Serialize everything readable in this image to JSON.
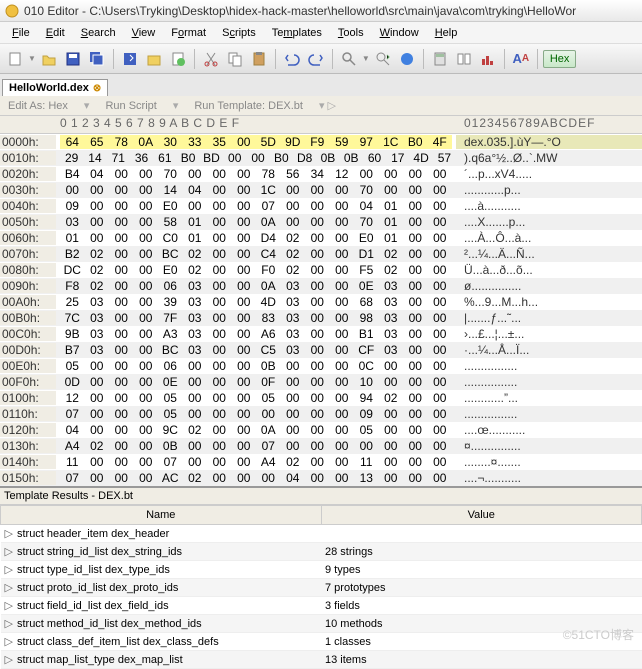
{
  "title": "010 Editor - C:\\Users\\Tryking\\Desktop\\hidex-hack-master\\helloworld\\src\\main\\java\\com\\tryking\\HelloWor",
  "menus": [
    "File",
    "Edit",
    "Search",
    "View",
    "Format",
    "Scripts",
    "Templates",
    "Tools",
    "Window",
    "Help"
  ],
  "tab": "HelloWorld.dex",
  "subbar": {
    "edit_as": "Edit As: Hex",
    "run_script": "Run Script",
    "run_template": "Run Template: DEX.bt"
  },
  "hex_header_bytes": "0  1  2  3  4  5  6  7  8  9  A  B  C  D  E  F",
  "hex_header_ascii": "0123456789ABCDEF",
  "rows": [
    {
      "a": "0000h:",
      "b": [
        "64",
        "65",
        "78",
        "0A",
        "30",
        "33",
        "35",
        "00",
        "5D",
        "9D",
        "F9",
        "59",
        "97",
        "1C",
        "B0",
        "4F"
      ],
      "t": "dex.035.].ùY—.°O",
      "hl": true
    },
    {
      "a": "0010h:",
      "b": [
        "29",
        "14",
        "71",
        "36",
        "61",
        "B0",
        "BD",
        "00",
        "00",
        "B0",
        "D8",
        "0B",
        "0B",
        "60",
        "17",
        "4D",
        "57"
      ],
      "t": ").q6a°½..Ø..`.MW"
    },
    {
      "a": "0020h:",
      "b": [
        "B4",
        "04",
        "00",
        "00",
        "70",
        "00",
        "00",
        "00",
        "78",
        "56",
        "34",
        "12",
        "00",
        "00",
        "00",
        "00"
      ],
      "t": "´...p...xV4....."
    },
    {
      "a": "0030h:",
      "b": [
        "00",
        "00",
        "00",
        "00",
        "14",
        "04",
        "00",
        "00",
        "1C",
        "00",
        "00",
        "00",
        "70",
        "00",
        "00",
        "00"
      ],
      "t": "............p..."
    },
    {
      "a": "0040h:",
      "b": [
        "09",
        "00",
        "00",
        "00",
        "E0",
        "00",
        "00",
        "00",
        "07",
        "00",
        "00",
        "00",
        "04",
        "01",
        "00",
        "00"
      ],
      "t": "....à..........."
    },
    {
      "a": "0050h:",
      "b": [
        "03",
        "00",
        "00",
        "00",
        "58",
        "01",
        "00",
        "00",
        "0A",
        "00",
        "00",
        "00",
        "70",
        "01",
        "00",
        "00"
      ],
      "t": "....X.......p..."
    },
    {
      "a": "0060h:",
      "b": [
        "01",
        "00",
        "00",
        "00",
        "C0",
        "01",
        "00",
        "00",
        "D4",
        "02",
        "00",
        "00",
        "E0",
        "01",
        "00",
        "00"
      ],
      "t": "....À...Ô...à..."
    },
    {
      "a": "0070h:",
      "b": [
        "B2",
        "02",
        "00",
        "00",
        "BC",
        "02",
        "00",
        "00",
        "C4",
        "02",
        "00",
        "00",
        "D1",
        "02",
        "00",
        "00"
      ],
      "t": "²...¼...Ä...Ñ..."
    },
    {
      "a": "0080h:",
      "b": [
        "DC",
        "02",
        "00",
        "00",
        "E0",
        "02",
        "00",
        "00",
        "F0",
        "02",
        "00",
        "00",
        "F5",
        "02",
        "00",
        "00"
      ],
      "t": "Ü...à...ð...õ..."
    },
    {
      "a": "0090h:",
      "b": [
        "F8",
        "02",
        "00",
        "00",
        "06",
        "03",
        "00",
        "00",
        "0A",
        "03",
        "00",
        "00",
        "0E",
        "03",
        "00",
        "00"
      ],
      "t": "ø..............."
    },
    {
      "a": "00A0h:",
      "b": [
        "25",
        "03",
        "00",
        "00",
        "39",
        "03",
        "00",
        "00",
        "4D",
        "03",
        "00",
        "00",
        "68",
        "03",
        "00",
        "00"
      ],
      "t": "%...9...M...h..."
    },
    {
      "a": "00B0h:",
      "b": [
        "7C",
        "03",
        "00",
        "00",
        "7F",
        "03",
        "00",
        "00",
        "83",
        "03",
        "00",
        "00",
        "98",
        "03",
        "00",
        "00"
      ],
      "t": "|.......ƒ...˜..."
    },
    {
      "a": "00C0h:",
      "b": [
        "9B",
        "03",
        "00",
        "00",
        "A3",
        "03",
        "00",
        "00",
        "A6",
        "03",
        "00",
        "00",
        "B1",
        "03",
        "00",
        "00"
      ],
      "t": "›...£...¦...±..."
    },
    {
      "a": "00D0h:",
      "b": [
        "B7",
        "03",
        "00",
        "00",
        "BC",
        "03",
        "00",
        "00",
        "C5",
        "03",
        "00",
        "00",
        "CF",
        "03",
        "00",
        "00"
      ],
      "t": "·...¼...Å...Ï..."
    },
    {
      "a": "00E0h:",
      "b": [
        "05",
        "00",
        "00",
        "00",
        "06",
        "00",
        "00",
        "00",
        "0B",
        "00",
        "00",
        "00",
        "0C",
        "00",
        "00",
        "00"
      ],
      "t": "................"
    },
    {
      "a": "00F0h:",
      "b": [
        "0D",
        "00",
        "00",
        "00",
        "0E",
        "00",
        "00",
        "00",
        "0F",
        "00",
        "00",
        "00",
        "10",
        "00",
        "00",
        "00"
      ],
      "t": "................"
    },
    {
      "a": "0100h:",
      "b": [
        "12",
        "00",
        "00",
        "00",
        "05",
        "00",
        "00",
        "00",
        "05",
        "00",
        "00",
        "00",
        "94",
        "02",
        "00",
        "00"
      ],
      "t": "............”..."
    },
    {
      "a": "0110h:",
      "b": [
        "07",
        "00",
        "00",
        "00",
        "05",
        "00",
        "00",
        "00",
        "00",
        "00",
        "00",
        "00",
        "09",
        "00",
        "00",
        "00"
      ],
      "t": "................"
    },
    {
      "a": "0120h:",
      "b": [
        "04",
        "00",
        "00",
        "00",
        "9C",
        "02",
        "00",
        "00",
        "0A",
        "00",
        "00",
        "00",
        "05",
        "00",
        "00",
        "00"
      ],
      "t": "....œ..........."
    },
    {
      "a": "0130h:",
      "b": [
        "A4",
        "02",
        "00",
        "00",
        "0B",
        "00",
        "00",
        "00",
        "07",
        "00",
        "00",
        "00",
        "00",
        "00",
        "00",
        "00"
      ],
      "t": "¤..............."
    },
    {
      "a": "0140h:",
      "b": [
        "11",
        "00",
        "00",
        "00",
        "07",
        "00",
        "00",
        "00",
        "A4",
        "02",
        "00",
        "00",
        "11",
        "00",
        "00",
        "00"
      ],
      "t": "........¤......."
    },
    {
      "a": "0150h:",
      "b": [
        "07",
        "00",
        "00",
        "00",
        "AC",
        "02",
        "00",
        "00",
        "00",
        "04",
        "00",
        "00",
        "13",
        "00",
        "00",
        "00"
      ],
      "t": "....¬..........."
    }
  ],
  "template_title": "Template Results - DEX.bt",
  "template_cols": {
    "name": "Name",
    "value": "Value"
  },
  "template_rows": [
    {
      "n": "struct header_item dex_header",
      "v": ""
    },
    {
      "n": "struct string_id_list dex_string_ids",
      "v": "28 strings"
    },
    {
      "n": "struct type_id_list dex_type_ids",
      "v": "9 types"
    },
    {
      "n": "struct proto_id_list dex_proto_ids",
      "v": "7 prototypes"
    },
    {
      "n": "struct field_id_list dex_field_ids",
      "v": "3 fields"
    },
    {
      "n": "struct method_id_list dex_method_ids",
      "v": "10 methods"
    },
    {
      "n": "struct class_def_item_list dex_class_defs",
      "v": "1 classes"
    },
    {
      "n": "struct map_list_type dex_map_list",
      "v": "13 items"
    }
  ],
  "hex_label": "Hex",
  "watermark": "©51CTO博客"
}
